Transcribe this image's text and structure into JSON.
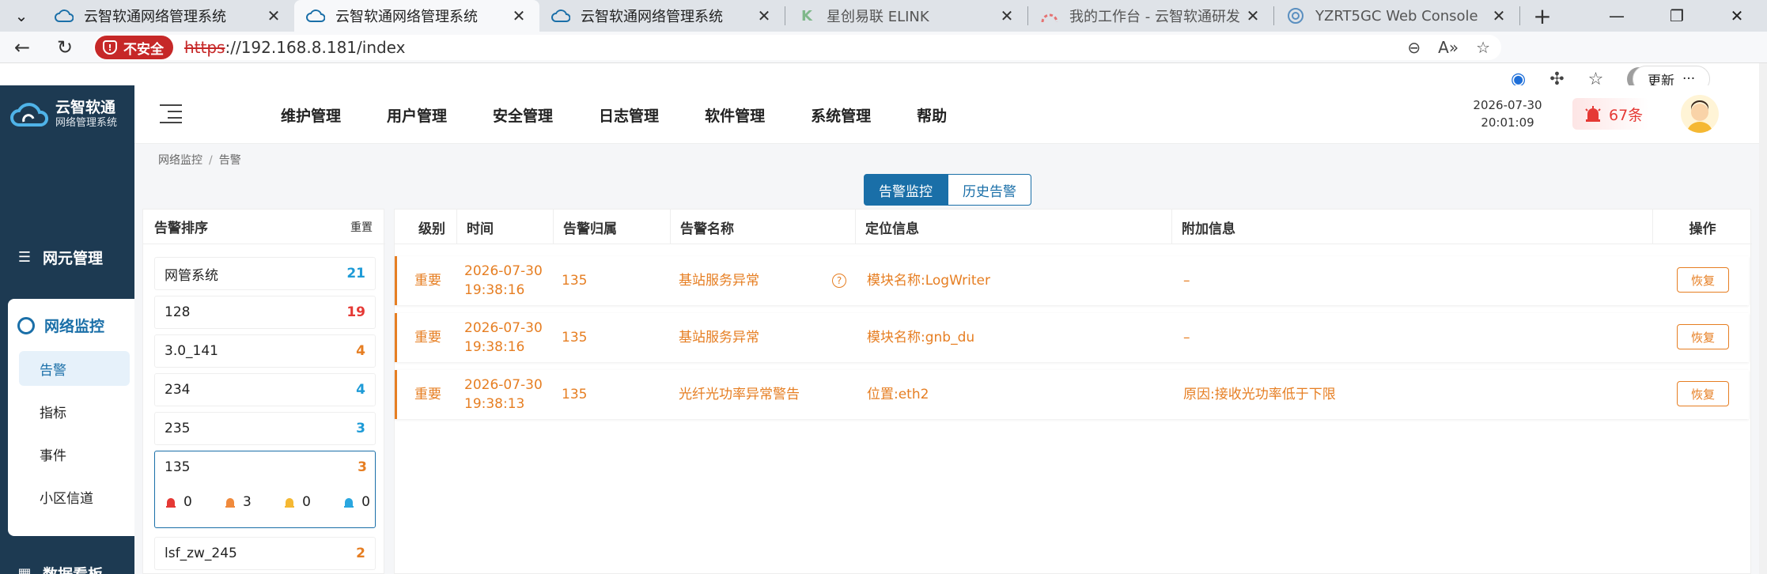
{
  "browser": {
    "tabs": [
      {
        "title": "云智软通网络管理系统",
        "icon": "cloud-icon",
        "active": false
      },
      {
        "title": "云智软通网络管理系统",
        "icon": "cloud-icon",
        "active": true
      },
      {
        "title": "云智软通网络管理系统",
        "icon": "cloud-icon",
        "active": false
      },
      {
        "title": "星创易联 ELINK",
        "icon": "elink-icon",
        "active": false
      },
      {
        "title": "我的工作台 - 云智软通研发",
        "icon": "workbench-icon",
        "active": false
      },
      {
        "title": "YZRT5GC Web Console",
        "icon": "console-icon",
        "active": false
      }
    ],
    "insecure_label": "不安全",
    "url_scheme": "https",
    "url_rest": "://192.168.8.181/index",
    "update_label": "更新"
  },
  "app": {
    "logo_title": "云智软通",
    "logo_subtitle": "网络管理系统",
    "sidebar": {
      "ne_management": "网元管理",
      "network_monitor": "网络监控",
      "sub_items": [
        "告警",
        "指标",
        "事件",
        "小区信道"
      ],
      "active_sub": "告警",
      "data_board": "数据看板"
    },
    "topnav": [
      "维护管理",
      "用户管理",
      "安全管理",
      "日志管理",
      "软件管理",
      "系统管理",
      "帮助"
    ],
    "date": "2026-07-30",
    "time": "20:01:09",
    "alarm_count": "67条",
    "breadcrumb": [
      "网络监控",
      "告警"
    ],
    "seg_tabs": [
      "告警监控",
      "历史告警"
    ],
    "rank_panel": {
      "title": "告警排序",
      "sort_label": "重置",
      "rows": [
        {
          "name": "网管系统",
          "count": "21",
          "color": "#1e9bd7"
        },
        {
          "name": "128",
          "count": "19",
          "color": "#e53935"
        },
        {
          "name": "3.0_141",
          "count": "4",
          "color": "#e67e22"
        },
        {
          "name": "234",
          "count": "4",
          "color": "#1e9bd7"
        },
        {
          "name": "235",
          "count": "3",
          "color": "#1e9bd7"
        },
        {
          "name": "135",
          "count": "3",
          "color": "#e67e22"
        },
        {
          "name": "lsf_zw_245",
          "count": "2",
          "color": "#e67e22"
        }
      ],
      "selected_severity": [
        "0",
        "3",
        "0",
        "0"
      ]
    },
    "table": {
      "headers": [
        "级别",
        "时间",
        "告警归属",
        "告警名称",
        "定位信息",
        "附加信息",
        "操作"
      ],
      "rows": [
        {
          "level": "重要",
          "date": "2026-07-30",
          "time": "19:38:16",
          "owner": "135",
          "name": "基站服务异常",
          "location": "模块名称:LogWriter",
          "extra": "–",
          "action": "恢复"
        },
        {
          "level": "重要",
          "date": "2026-07-30",
          "time": "19:38:16",
          "owner": "135",
          "name": "基站服务异常",
          "location": "模块名称:gnb_du",
          "extra": "–",
          "action": "恢复"
        },
        {
          "level": "重要",
          "date": "2026-07-30",
          "time": "19:38:13",
          "owner": "135",
          "name": "光纤光功率异常警告",
          "location": "位置:eth2",
          "extra": "原因:接收光功率低于下限",
          "action": "恢复"
        }
      ]
    }
  }
}
